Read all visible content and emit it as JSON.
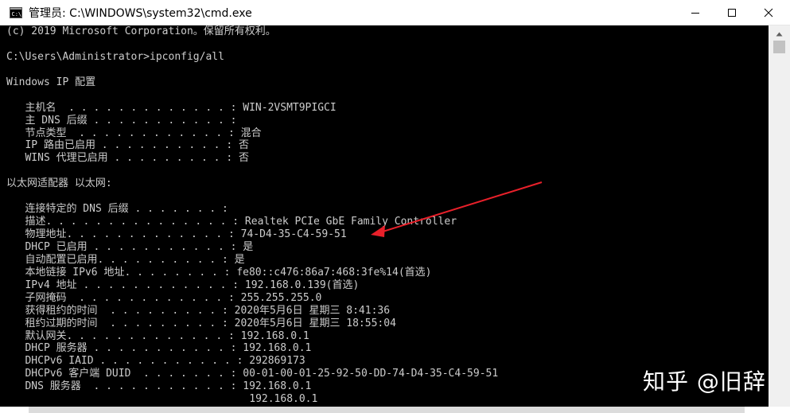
{
  "window": {
    "title": "管理员: C:\\WINDOWS\\system32\\cmd.exe",
    "icon": "cmd-icon",
    "controls": {
      "minimize": "minimize-icon",
      "maximize": "maximize-icon",
      "close": "close-icon"
    }
  },
  "console": {
    "text_color": "#cccccc",
    "background": "#000000",
    "lines": [
      "(c) 2019 Microsoft Corporation。保留所有权利。",
      "",
      "C:\\Users\\Administrator>ipconfig/all",
      "",
      "Windows IP 配置",
      "",
      "   主机名  . . . . . . . . . . . . . : WIN-2VSMT9PIGCI",
      "   主 DNS 后缀 . . . . . . . . . . . :",
      "   节点类型  . . . . . . . . . . . . : 混合",
      "   IP 路由已启用 . . . . . . . . . . : 否",
      "   WINS 代理已启用 . . . . . . . . . : 否",
      "",
      "以太网适配器 以太网:",
      "",
      "   连接特定的 DNS 后缀 . . . . . . . :",
      "   描述. . . . . . . . . . . . . . . : Realtek PCIe GbE Family Controller",
      "   物理地址. . . . . . . . . . . . . : 74-D4-35-C4-59-51",
      "   DHCP 已启用 . . . . . . . . . . . : 是",
      "   自动配置已启用. . . . . . . . . . : 是",
      "   本地链接 IPv6 地址. . . . . . . . : fe80::c476:86a7:468:3fe%14(首选)",
      "   IPv4 地址 . . . . . . . . . . . . : 192.168.0.139(首选)",
      "   子网掩码  . . . . . . . . . . . . : 255.255.255.0",
      "   获得租约的时间  . . . . . . . . . : 2020年5月6日 星期三 8:41:36",
      "   租约过期的时间  . . . . . . . . . : 2020年5月6日 星期三 18:55:04",
      "   默认网关. . . . . . . . . . . . . : 192.168.0.1",
      "   DHCP 服务器 . . . . . . . . . . . : 192.168.0.1",
      "   DHCPv6 IAID . . . . . . . . . . . : 292869173",
      "   DHCPv6 客户端 DUID  . . . . . . . : 00-01-00-01-25-92-50-DD-74-D4-35-C4-59-51",
      "   DNS 服务器  . . . . . . . . . . . : 192.168.0.1",
      "                                       192.168.0.1"
    ]
  },
  "annotation": {
    "arrow_color": "#e8202a"
  },
  "watermark": {
    "text": "知乎 @旧辞"
  },
  "scrollbar": {
    "up_icon": "scroll-up-arrow-icon"
  }
}
